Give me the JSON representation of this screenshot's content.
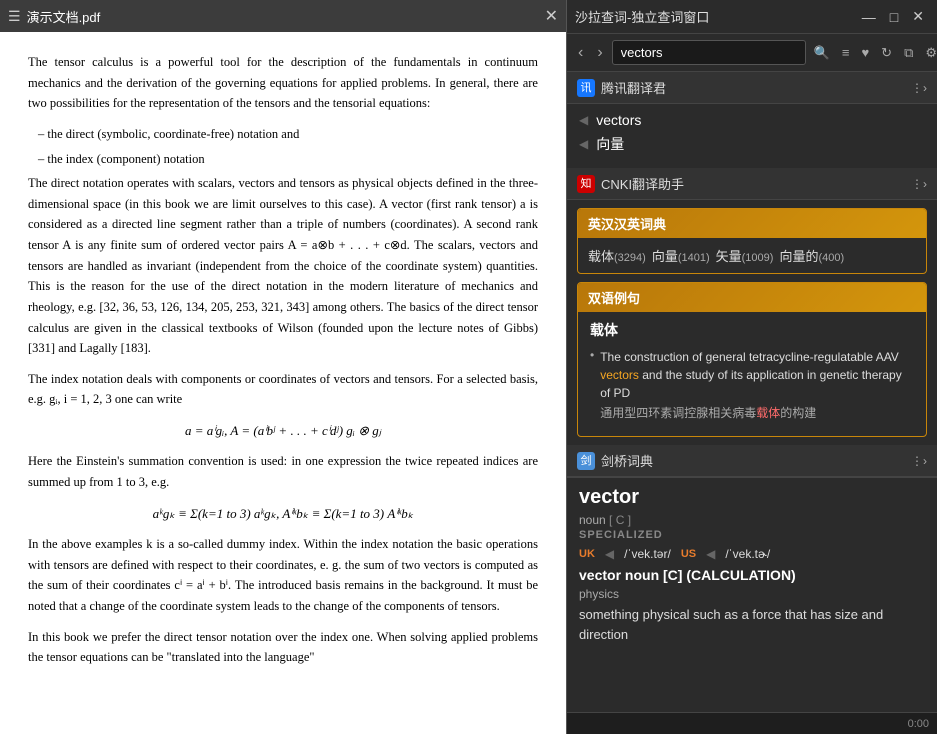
{
  "pdf": {
    "title": "演示文档.pdf",
    "content": {
      "para1": "The tensor calculus is a powerful tool for the description of the fundamentals in continuum mechanics and the derivation of the governing equations for applied problems. In general, there are two possibilities for the representation of the tensors and the tensorial equations:",
      "item1": "–  the direct (symbolic, coordinate-free) notation and",
      "item2": "–  the index (component) notation",
      "para2": "The direct notation operates with scalars, vectors and tensors as physical objects defined in the three-dimensional space (in this book we are limit ourselves to this case). A vector (first rank tensor) a is considered as a directed line segment rather than a triple of numbers (coordinates). A second rank tensor A is any finite sum of ordered vector pairs A = a⊗b + . . . + c⊗d. The scalars, vectors and tensors are handled as invariant (independent from the choice of the coordinate system) quantities. This is the reason for the use of the direct notation in the modern literature of mechanics and rheology, e.g. [32, 36, 53, 126, 134, 205, 253, 321, 343] among others. The basics of the direct tensor calculus are given in the classical textbooks of Wilson (founded upon the lecture notes of Gibbs) [331] and Lagally [183].",
      "para3": "The index notation deals with components or coordinates of vectors and tensors. For a selected basis, e.g. gᵢ, i = 1, 2, 3 one can write",
      "math1": "a = aⁱgᵢ,    A = (aⁱbʲ + . . . + cⁱdʲ) gᵢ ⊗ gⱼ",
      "para4": "Here the Einstein's summation convention is used: in one expression the twice repeated indices are summed up from 1 to 3, e.g.",
      "math2": "aᵏgₖ ≡ Σ(k=1 to 3) aᵏgₖ,    Aⁱᵏbₖ ≡ Σ(k=1 to 3) Aⁱᵏbₖ",
      "para5": "In the above examples k is a so-called dummy index. Within the index notation the basic operations with tensors are defined with respect to their coordinates, e. g. the sum of two vectors is computed as the sum of their coordinates cⁱ = aⁱ + bⁱ. The introduced basis remains in the background. It must be noted that a change of the coordinate system leads to the change of the components of tensors.",
      "para6": "In this book we prefer the direct tensor notation over the index one. When solving applied problems the tensor equations can be \"translated into the language\""
    }
  },
  "dict": {
    "title": "沙拉查词-独立查词窗口",
    "search_value": "vectors",
    "tencent": {
      "name": "腾讯翻译君",
      "en_word": "vectors",
      "zh_word": "向量"
    },
    "cnki": {
      "name": "CNKI翻译助手",
      "dict_title": "英汉汉英词典",
      "entries": [
        {
          "label": "载体",
          "count": "3294"
        },
        {
          "label": "向量",
          "count": "1401"
        },
        {
          "label": "矢量",
          "count": "1009"
        },
        {
          "label": "向量的",
          "count": "400"
        }
      ]
    },
    "bilingual": {
      "title": "双语例句",
      "main_word": "载体",
      "example_en": "The construction of general tetracycline-regulatable AAV vectors and the study of its application in genetic therapy of PD",
      "highlight_en": "vectors",
      "example_zh": "通用型四环素调控腺相关病毒载体的构建",
      "highlight_zh": "载体"
    },
    "cambridge": {
      "name": "剑桥词典",
      "word": "vector",
      "pos": "noun",
      "bracket": "[ C ]",
      "tag": "SPECIALIZED",
      "uk_pron": "UK",
      "uk_ipa": "/ˈvek.tər/",
      "us_pron": "US",
      "us_ipa": "/ˈvek.tɚ/",
      "full_entry": "vector noun [C] (CALCULATION)",
      "subject": "physics",
      "definition": "something physical such as a force that has size and direction"
    },
    "status": "0:00"
  }
}
